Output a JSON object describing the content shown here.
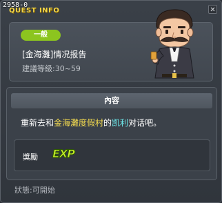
{
  "quest_id": "2958-0",
  "window_title": "QUEST INFO",
  "header": {
    "category": "一般",
    "quest_title": "[金海灘]情况报告",
    "level_label": "建議等級:",
    "level_range": "30~59"
  },
  "content": {
    "section_title": "內容",
    "description_parts": [
      "重新去和",
      "金海灘度假村",
      "的",
      "凯利",
      "对话吧。"
    ]
  },
  "reward": {
    "label": "獎勵",
    "exp_text": "EXP"
  },
  "status": {
    "label": "狀態:",
    "value": "可開始"
  },
  "icons": {
    "close": "close-icon",
    "npc": "npc-portrait"
  },
  "colors": {
    "title_yellow": "#f2d64a",
    "badge_green": "#8cc51f",
    "highlight_yellow": "#f5dc50",
    "highlight_cyan": "#6ee8ea",
    "exp_green": "#c8f02a"
  }
}
